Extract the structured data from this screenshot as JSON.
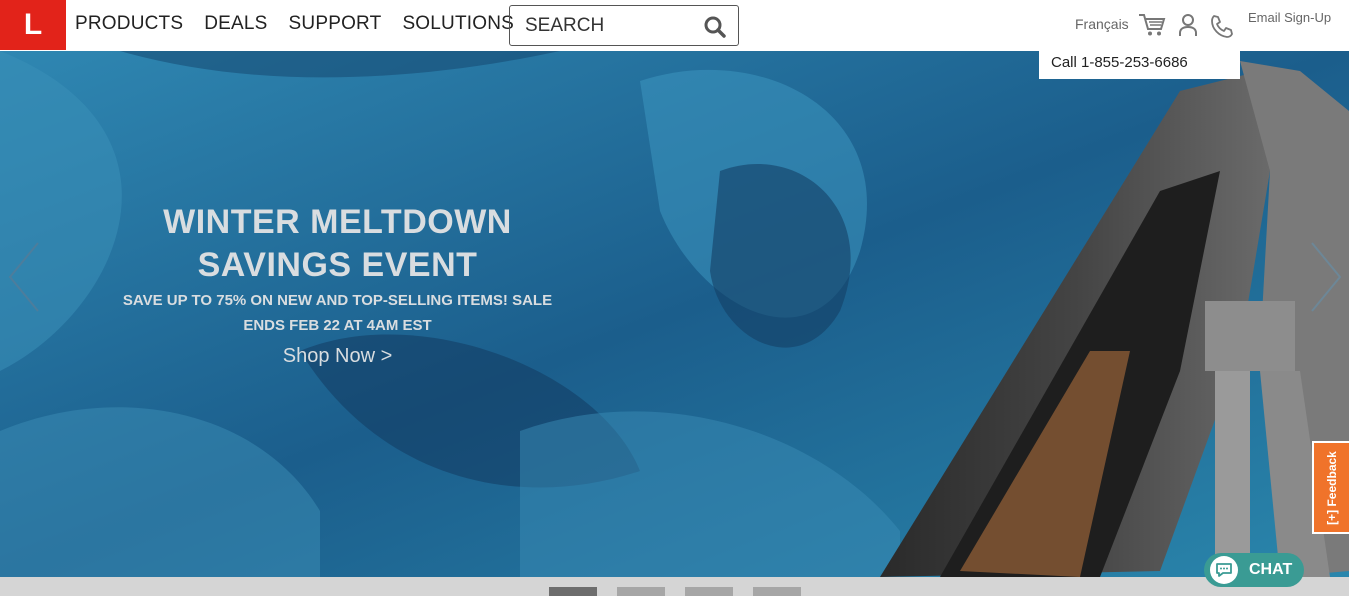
{
  "header": {
    "logo_text": "L",
    "nav": [
      "PRODUCTS",
      "DEALS",
      "SUPPORT",
      "SOLUTIONS"
    ],
    "search_placeholder": "SEARCH",
    "language": "Français",
    "email_signup": "Email Sign-Up"
  },
  "call_popup": {
    "text": "Call 1-855-253-6686"
  },
  "hero": {
    "title_line1": "WINTER MELTDOWN",
    "title_line2": "SAVINGS EVENT",
    "subtitle_line1": "SAVE UP TO 75% ON NEW AND TOP-SELLING ITEMS! SALE",
    "subtitle_line2": "ENDS FEB 22 AT 4AM EST",
    "cta": "Shop Now >"
  },
  "feedback": {
    "label": "[+] Feedback"
  },
  "chat": {
    "label": "CHAT"
  },
  "carousel": {
    "slide_count": 4,
    "active_index": 0
  },
  "colors": {
    "brand": "#e2231a",
    "feedback": "#f0732a",
    "chat": "#3a9b94",
    "hero_text": "#d9dde0"
  }
}
